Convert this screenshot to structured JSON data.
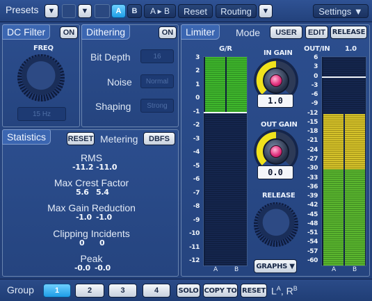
{
  "topbar": {
    "presets_label": "Presets",
    "ab_a": "A",
    "ab_b": "B",
    "copy_ab": "A ▸ B",
    "reset": "Reset",
    "routing": "Routing",
    "settings": "Settings ▼",
    "dropdown_glyph": "▼"
  },
  "dc_filter": {
    "title": "DC Filter",
    "on_button": "ON",
    "freq_label": "FREQ",
    "freq_value": "15 Hz"
  },
  "dithering": {
    "title": "Dithering",
    "on_button": "ON",
    "bit_depth_label": "Bit Depth",
    "bit_depth_value": "16",
    "noise_label": "Noise",
    "noise_value": "Normal",
    "shaping_label": "Shaping",
    "shaping_value": "Strong"
  },
  "statistics": {
    "title": "Statistics",
    "reset_button": "RESET",
    "metering_label": "Metering",
    "metering_button": "DBFS",
    "rows": [
      {
        "label": "RMS",
        "left": "-11.2",
        "right": "-11.0"
      },
      {
        "label": "Max Crest Factor",
        "left": "5.6",
        "right": "5.4"
      },
      {
        "label": "Max Gain Reduction",
        "left": "-1.0",
        "right": "-1.0"
      },
      {
        "label": "Clipping Incidents",
        "left": "0",
        "right": "0"
      },
      {
        "label": "Peak",
        "left": "-0.0",
        "right": "-0.0"
      }
    ]
  },
  "limiter": {
    "title": "Limiter",
    "mode_label": "Mode",
    "user_button": "USER",
    "edit_button": "EDIT",
    "release_button": "RELEASE",
    "gr_label": "G/R",
    "gr_scale": [
      "3",
      "2",
      "1",
      "0",
      "-1",
      "-2",
      "-3",
      "-4",
      "-5",
      "-6",
      "-7",
      "-8",
      "-9",
      "-10",
      "-11",
      "-12"
    ],
    "in_gain_label": "IN GAIN",
    "in_gain_value": "1.0",
    "out_gain_label": "OUT GAIN",
    "out_gain_value": "0.0",
    "release_knob_label": "RELEASE",
    "graphs_button": "GRAPHS ▼",
    "outin_label": "OUT/IN",
    "outin_value": "1.0",
    "out_scale": [
      "6",
      "3",
      "0",
      "-3",
      "-6",
      "-9",
      "-12",
      "-15",
      "-18",
      "-21",
      "-24",
      "-27",
      "-30",
      "-33",
      "-36",
      "-39",
      "-42",
      "-45",
      "-48",
      "-51",
      "-54",
      "-57",
      "-60"
    ],
    "channel_a": "A",
    "channel_b": "B",
    "gr_level_db": -1.0,
    "outin_level_db": -12.0,
    "colors": {
      "gr_fill": "#3fb62c",
      "out_upper": "#d5c22a",
      "out_lower": "#5ab52e",
      "knob_cap": "#e2337f"
    }
  },
  "bottombar": {
    "group_label": "Group",
    "groups": [
      "1",
      "2",
      "3",
      "4"
    ],
    "solo": "SOLO",
    "copy_to": "COPY TO",
    "reset": "RESET",
    "channel_legend_l": "L",
    "channel_legend_l_sup": "A",
    "channel_legend_r": "R",
    "channel_legend_r_sup": "B"
  }
}
